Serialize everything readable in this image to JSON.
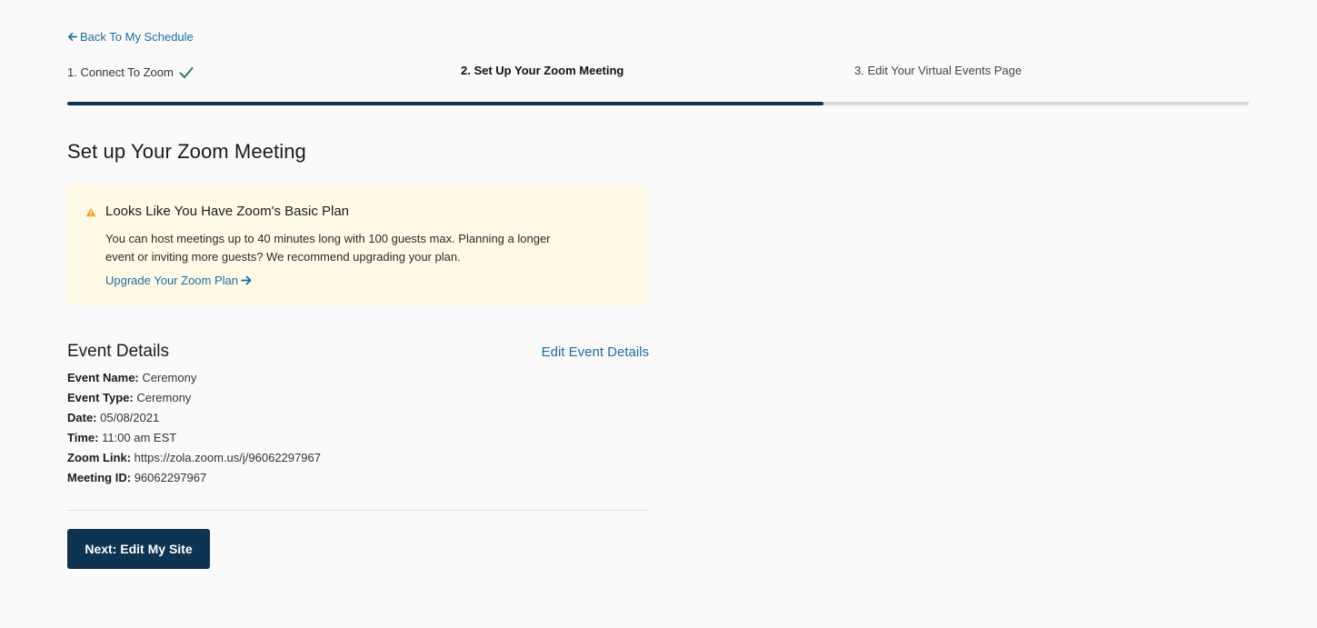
{
  "nav": {
    "back_label": "Back To My Schedule"
  },
  "steps": [
    {
      "label": "1. Connect To Zoom",
      "completed": true
    },
    {
      "label": "2. Set Up Your Zoom Meeting",
      "active": true
    },
    {
      "label": "3. Edit Your Virtual Events Page"
    }
  ],
  "progress": {
    "fraction": 0.64,
    "fill_color": "#0e3453",
    "track_color": "#d9d9d9"
  },
  "page_title": "Set up Your Zoom Meeting",
  "notice": {
    "icon": "warning-icon",
    "title": "Looks Like You Have Zoom's Basic Plan",
    "body": "You can host meetings up to 40 minutes long with 100 guests max. Planning a longer event or inviting more guests? We recommend upgrading your plan.",
    "link_label": "Upgrade Your Zoom Plan",
    "background": "#fffae6"
  },
  "event_details": {
    "heading": "Event Details",
    "edit_label": "Edit Event Details",
    "rows": [
      {
        "label": "Event Name:",
        "value": "Ceremony"
      },
      {
        "label": "Event Type:",
        "value": "Ceremony"
      },
      {
        "label": "Date:",
        "value": "05/08/2021"
      },
      {
        "label": "Time:",
        "value": "11:00 am EST"
      },
      {
        "label": "Zoom Link:",
        "value": "https://zola.zoom.us/j/96062297967"
      },
      {
        "label": "Meeting ID:",
        "value": "96062297967"
      }
    ]
  },
  "next_button_label": "Next: Edit My Site",
  "colors": {
    "link": "#1a6ea1",
    "primary": "#0e3453",
    "check": "#2e7d5b",
    "warning": "#f0a030"
  }
}
